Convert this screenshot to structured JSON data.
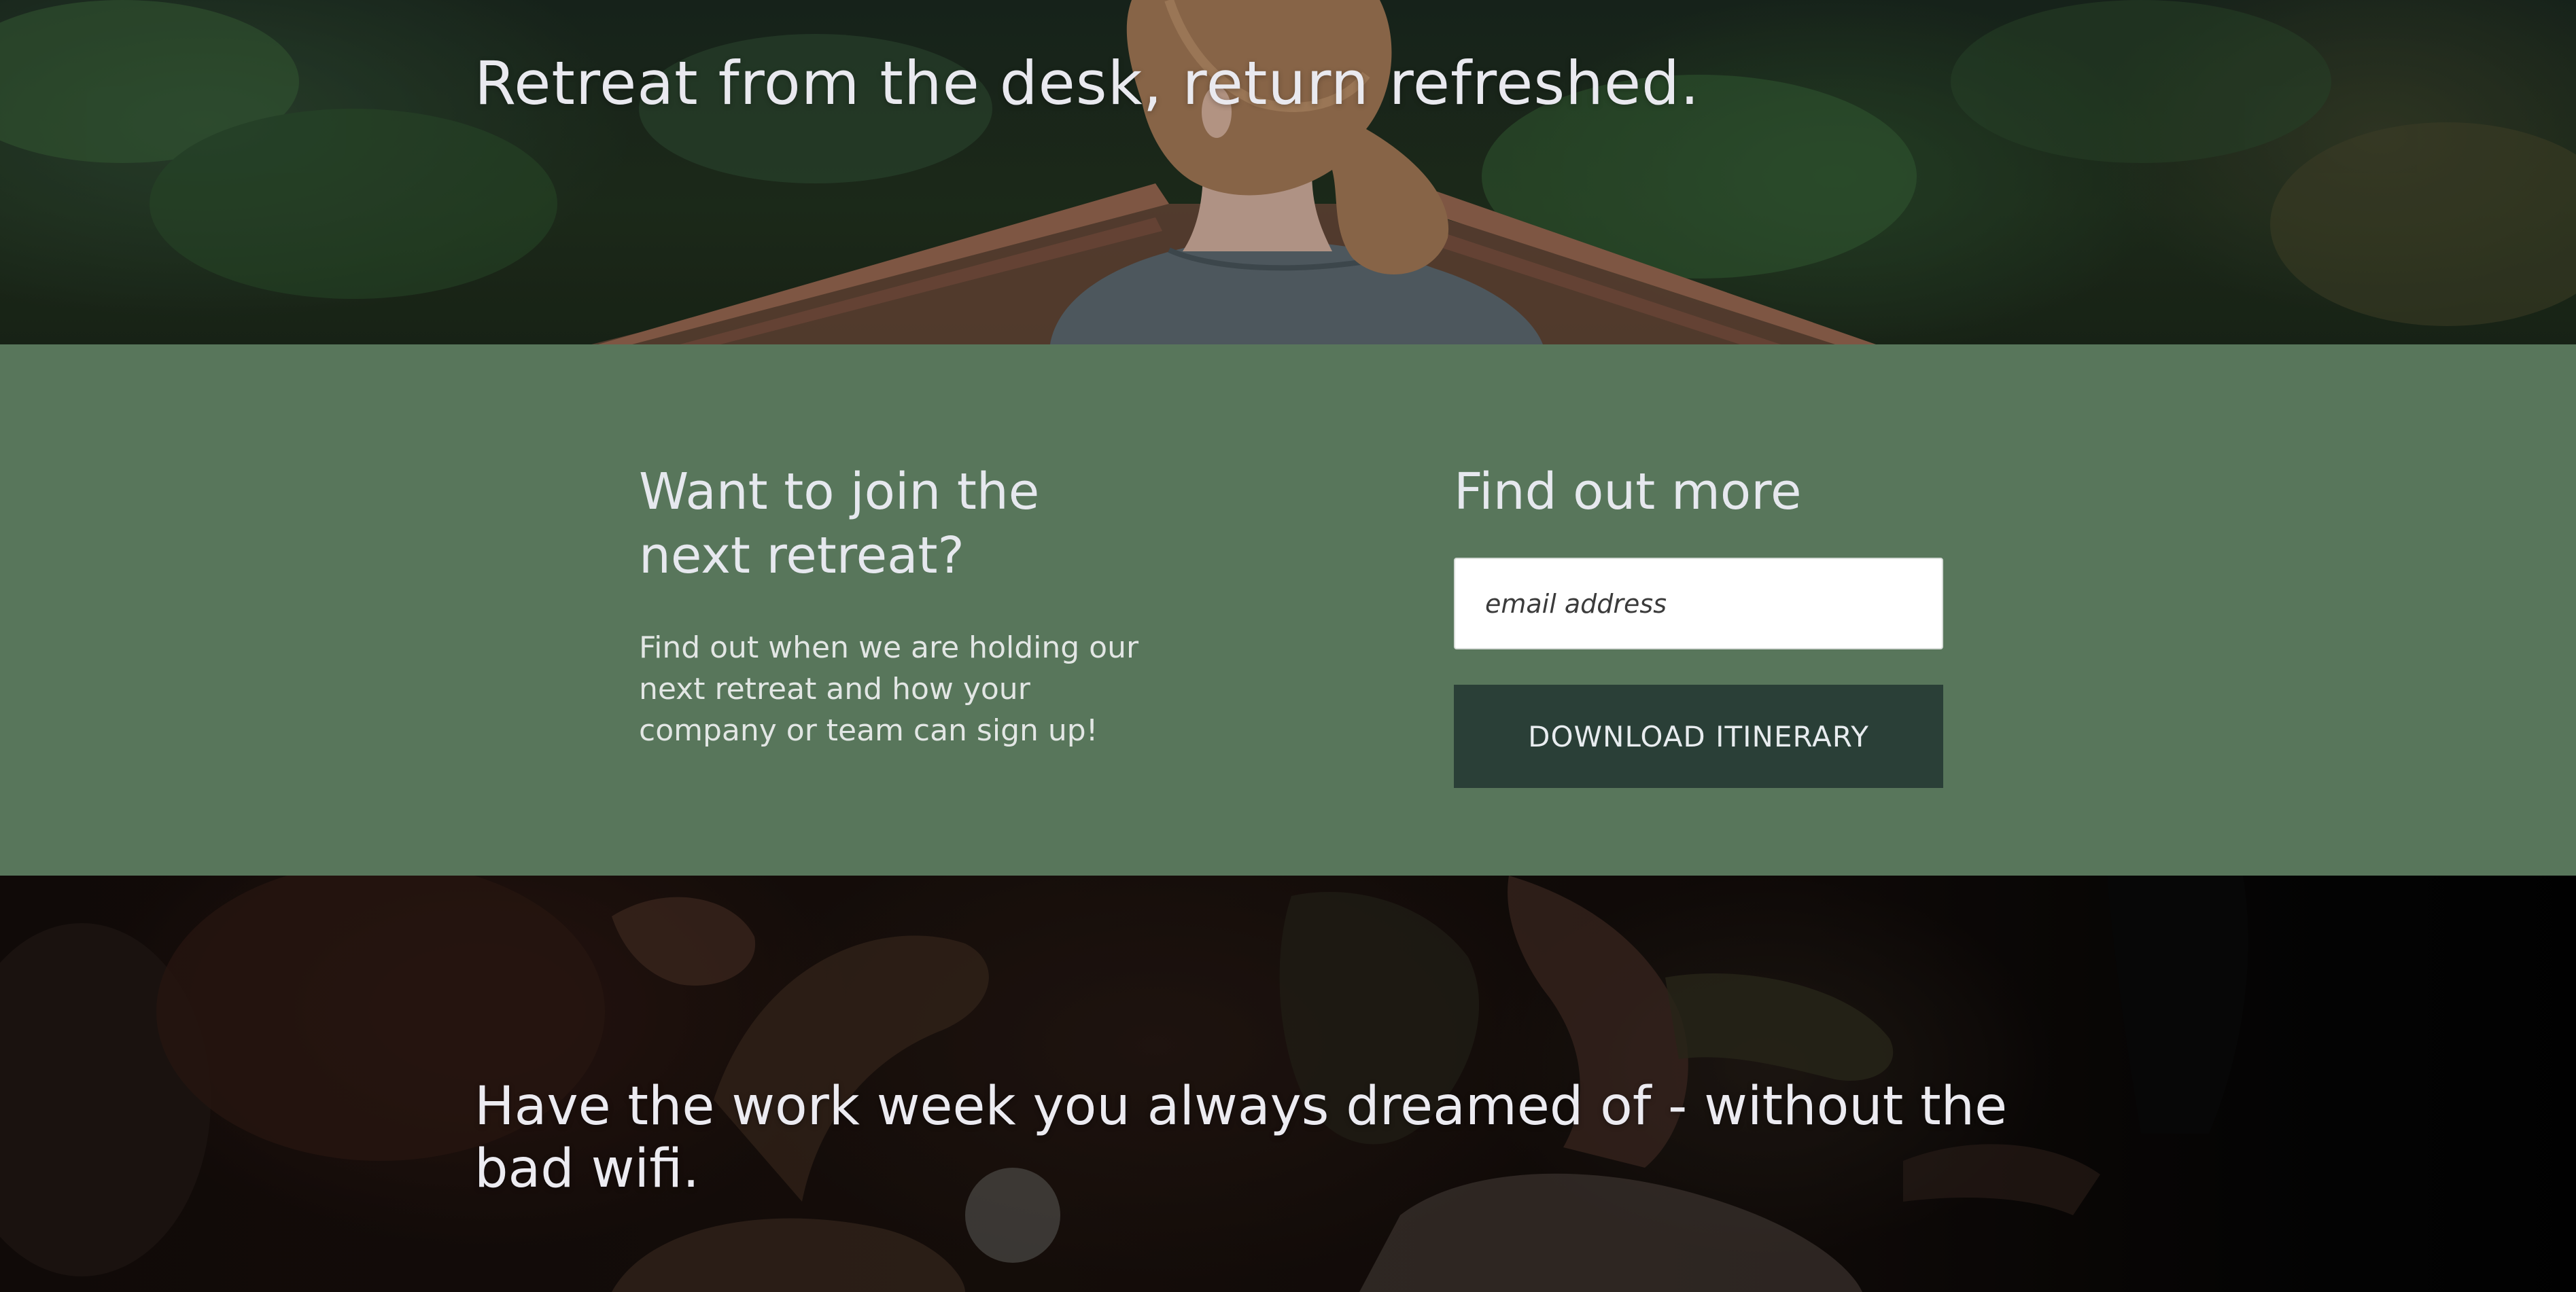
{
  "hero": {
    "title": "Retreat from the desk, return refreshed."
  },
  "cta": {
    "heading": "Want to join the next retreat?",
    "description": "Find out when we are holding our next retreat and how your company or team can sign up!",
    "form": {
      "heading": "Find out more",
      "email_placeholder": "email address",
      "button_label": "Download Itinerary"
    }
  },
  "closing": {
    "title": "Have the work week you always dreamed of - without the bad wifi."
  },
  "colors": {
    "band_green": "#58765b",
    "button_dark": "#2a3f37",
    "text_light": "#e6e8ee"
  }
}
